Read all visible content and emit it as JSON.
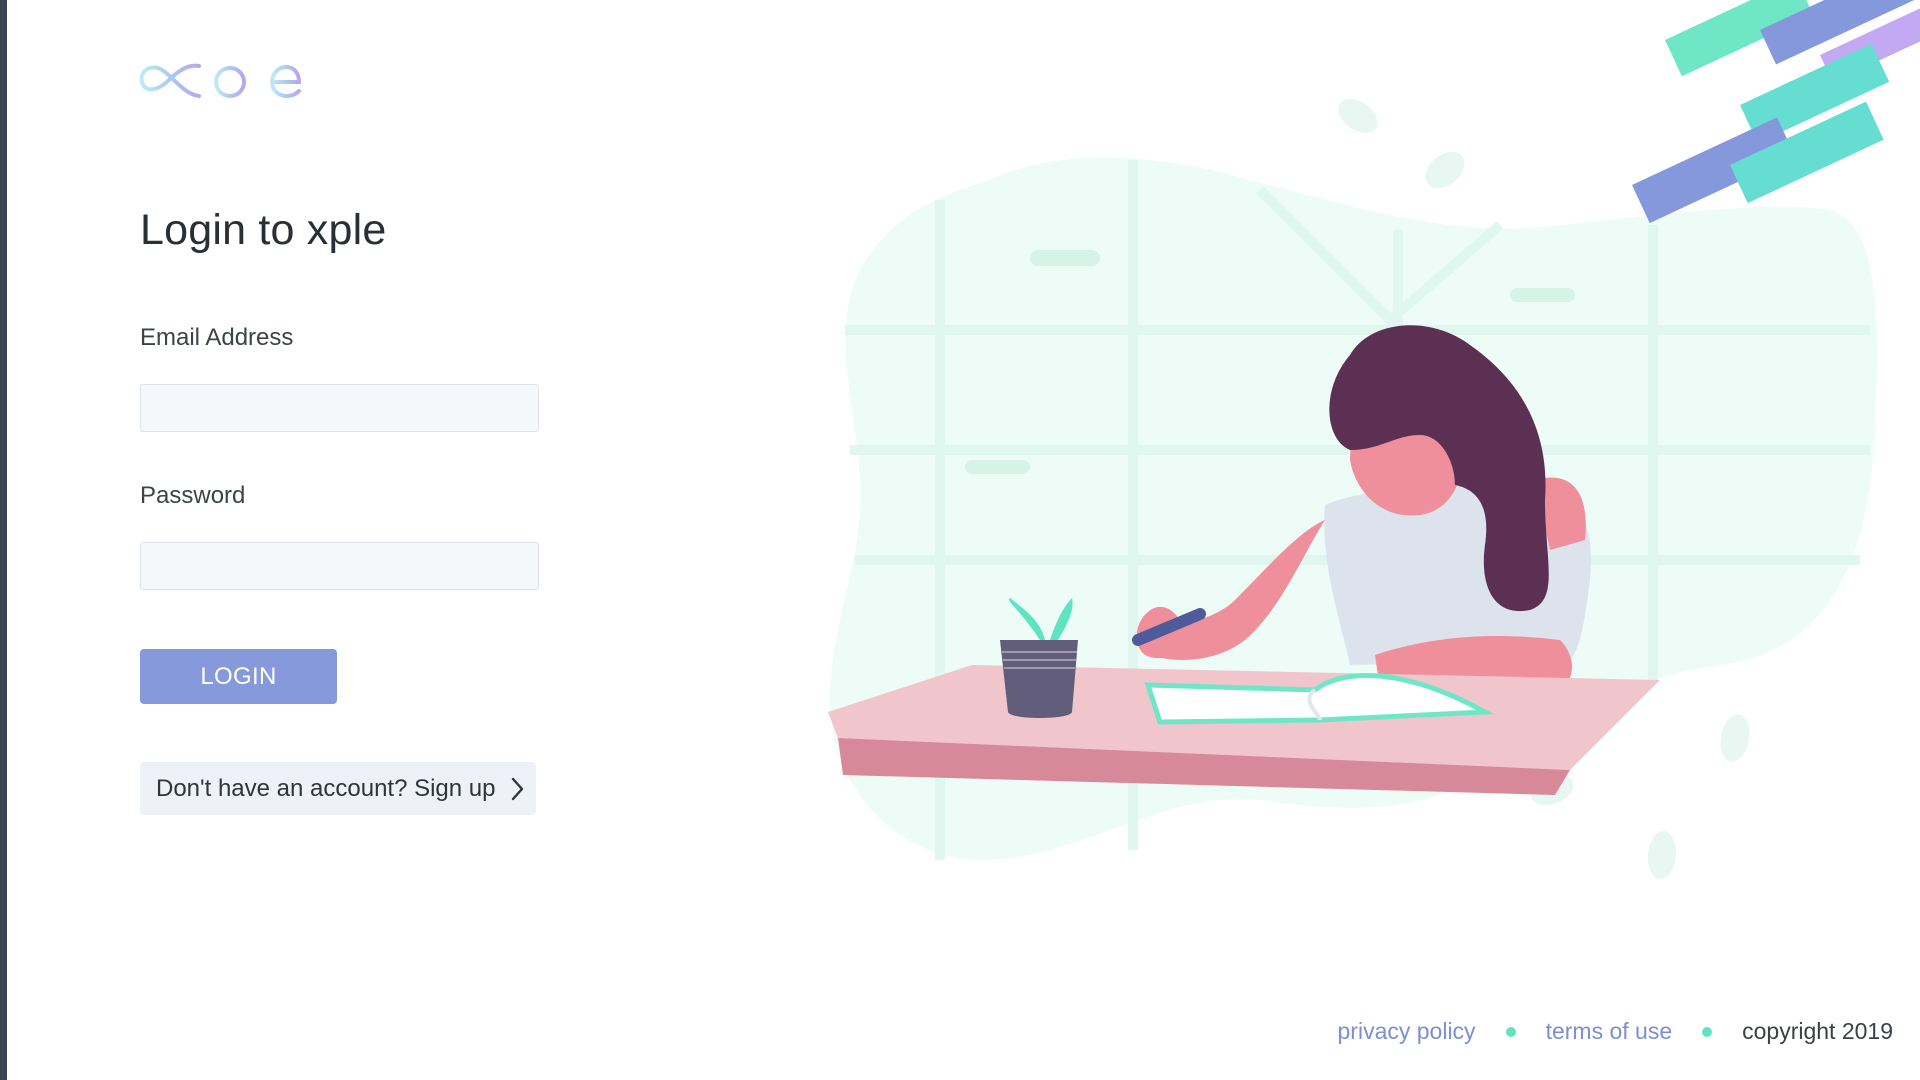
{
  "logo": {
    "text": "xple"
  },
  "login": {
    "title": "Login to xple",
    "email_label": "Email Address",
    "email_value": "",
    "password_label": "Password",
    "password_value": "",
    "button_label": "LOGIN",
    "signup_text": "Don't have an account? Sign up"
  },
  "footer": {
    "privacy": "privacy policy",
    "terms": "terms of use",
    "copyright": "copyright 2019"
  },
  "colors": {
    "accent": "#8599db",
    "teal": "#5fe3c1",
    "link": "#7d8fd0",
    "hair": "#5c3052",
    "skin": "#ef8f9b",
    "desk": "#efc5cc"
  },
  "icons": {
    "chevron": "chevron-right-icon",
    "footer_separator": "dot-icon"
  }
}
